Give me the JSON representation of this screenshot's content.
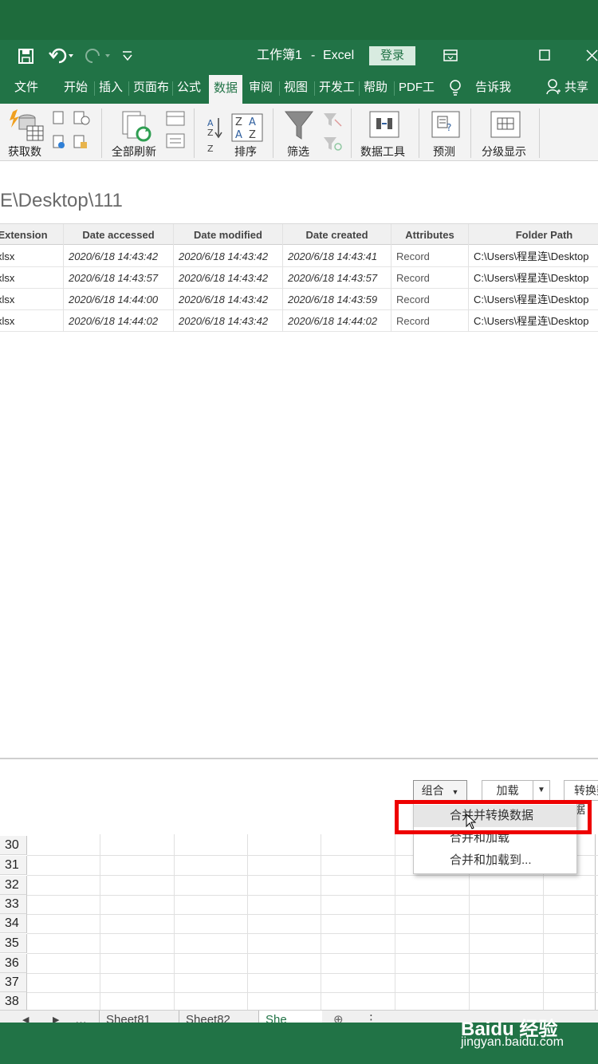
{
  "title_bar": {
    "workbook_title": "工作簿1",
    "separator": "-",
    "app_name": "Excel",
    "login_label": "登录"
  },
  "ribbon_tabs": [
    "文件",
    "开始",
    "插入",
    "页面布",
    "公式",
    "数据",
    "审阅",
    "视图",
    "开发工",
    "帮助",
    "PDF工",
    "告诉我",
    "共享"
  ],
  "active_tab": "数据",
  "ribbon_groups": {
    "get_data": "获取数",
    "refresh_all": "全部刷新",
    "sort": "排序",
    "filter": "筛选",
    "data_tools": "数据工具",
    "forecast": "预测",
    "outline": "分级显示"
  },
  "query": {
    "title": "E\\Desktop\\111",
    "columns": [
      "Extension",
      "Date accessed",
      "Date modified",
      "Date created",
      "Attributes",
      "Folder Path"
    ],
    "rows": [
      [
        "xlsx",
        "2020/6/18 14:43:42",
        "2020/6/18 14:43:42",
        "2020/6/18 14:43:41",
        "Record",
        "C:\\Users\\程星连\\Desktop"
      ],
      [
        "xlsx",
        "2020/6/18 14:43:57",
        "2020/6/18 14:43:42",
        "2020/6/18 14:43:57",
        "Record",
        "C:\\Users\\程星连\\Desktop"
      ],
      [
        "xlsx",
        "2020/6/18 14:44:00",
        "2020/6/18 14:43:42",
        "2020/6/18 14:43:59",
        "Record",
        "C:\\Users\\程星连\\Desktop"
      ],
      [
        "xlsx",
        "2020/6/18 14:44:02",
        "2020/6/18 14:43:42",
        "2020/6/18 14:44:02",
        "Record",
        "C:\\Users\\程星连\\Desktop"
      ]
    ]
  },
  "actions": {
    "combine_label": "组合",
    "load_label": "加载",
    "transform_label": "转换数据"
  },
  "combine_menu": [
    {
      "label": "合并并转换数据",
      "highlighted": true
    },
    {
      "label": "合并和加载",
      "highlighted": false
    },
    {
      "label": "合并和加载到...",
      "highlighted": false
    }
  ],
  "row_numbers": [
    "30",
    "31",
    "32",
    "33",
    "34",
    "35",
    "36",
    "37",
    "38"
  ],
  "sheet_tabs": [
    "Sheet81",
    "Sheet82",
    "She"
  ],
  "watermark": {
    "brand": "Baidu 经验",
    "url": "jingyan.baidu.com"
  },
  "colors": {
    "excel_green": "#217346",
    "frame_green": "#1e6b3c",
    "highlight_red": "#ee0000"
  }
}
